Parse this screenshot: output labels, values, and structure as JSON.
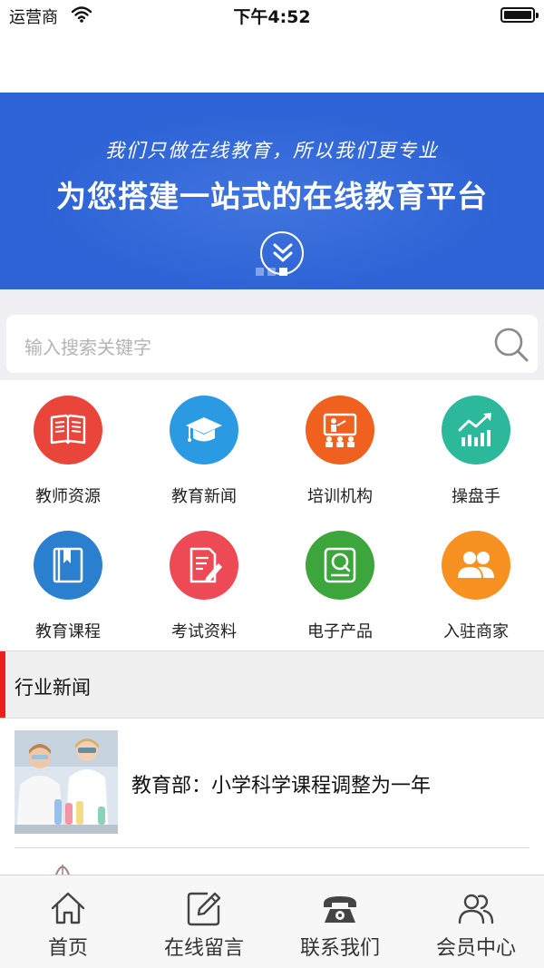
{
  "status_bar": {
    "carrier": "运营商",
    "time": "下午4:52"
  },
  "banner": {
    "subtitle": "我们只做在线教育，所以我们更专业",
    "title": "为您搭建一站式的在线教育平台",
    "page_count": 3,
    "active_page": 3,
    "background_color": "#2d63d6"
  },
  "search": {
    "placeholder": "输入搜索关键字"
  },
  "categories": [
    {
      "label": "教师资源",
      "icon": "book-icon",
      "color": "#e9453a"
    },
    {
      "label": "教育新闻",
      "icon": "graduation-cap-icon",
      "color": "#2a9ae3"
    },
    {
      "label": "培训机构",
      "icon": "classroom-icon",
      "color": "#f0611f"
    },
    {
      "label": "操盘手",
      "icon": "trend-chart-icon",
      "color": "#2cb89a"
    },
    {
      "label": "教育课程",
      "icon": "course-book-icon",
      "color": "#2b7fcf"
    },
    {
      "label": "考试资料",
      "icon": "exam-paper-icon",
      "color": "#ed4a55"
    },
    {
      "label": "电子产品",
      "icon": "device-icon",
      "color": "#3ca63c"
    },
    {
      "label": "入驻商家",
      "icon": "merchants-icon",
      "color": "#f79121"
    }
  ],
  "section": {
    "title": "行业新闻",
    "accent_color": "#e8211a"
  },
  "news": [
    {
      "title": "教育部：小学科学课程调整为一年"
    }
  ],
  "tabs": [
    {
      "label": "首页",
      "icon": "home-icon"
    },
    {
      "label": "在线留言",
      "icon": "edit-icon"
    },
    {
      "label": "联系我们",
      "icon": "phone-icon"
    },
    {
      "label": "会员中心",
      "icon": "members-icon"
    }
  ]
}
